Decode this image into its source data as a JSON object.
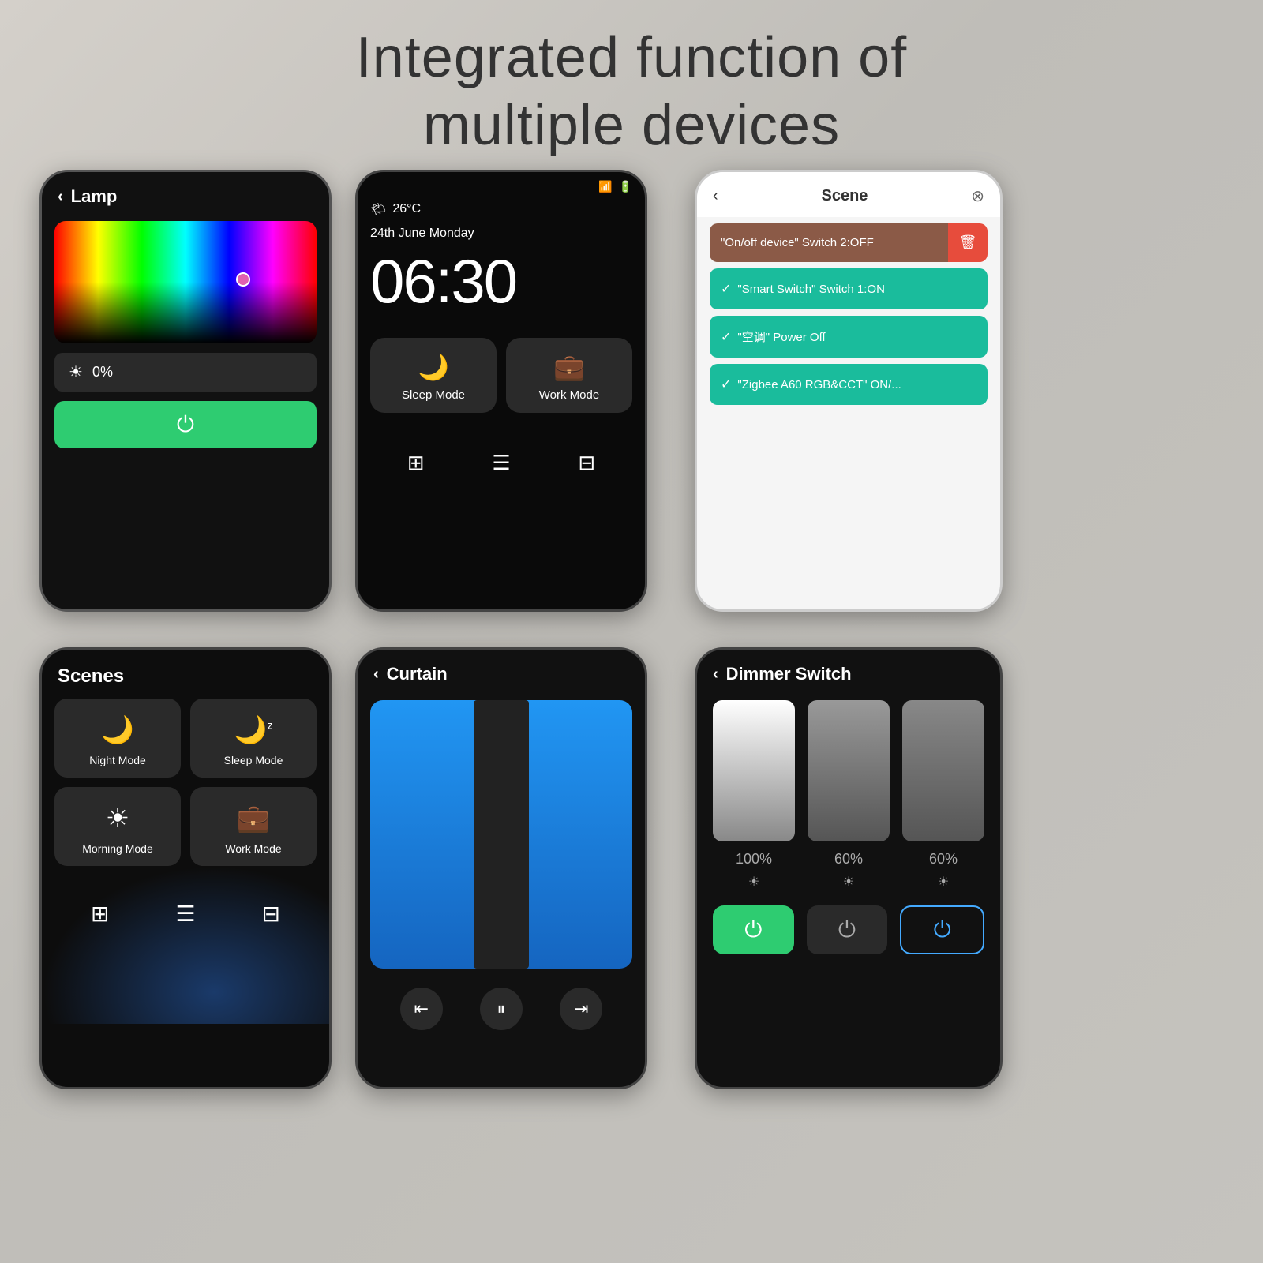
{
  "page": {
    "heading_line1": "Integrated function of",
    "heading_line2": "multiple devices",
    "bg_color": "#c8c5be"
  },
  "phone1": {
    "title": "Lamp",
    "brightness": "0%",
    "power_icon": "⏻"
  },
  "phone2": {
    "temperature": "26°C",
    "date": "24th June  Monday",
    "time": "06:30",
    "btn1_label": "Sleep Mode",
    "btn2_label": "Work Mode"
  },
  "phone3": {
    "title": "Scene",
    "row1": "\"On/off device\" Switch 2:OFF",
    "row2": "\"Smart Switch\" Switch 1:ON",
    "row3": "\"空调\" Power Off",
    "row4": "\"Zigbee A60 RGB&CCT\" ON/..."
  },
  "phone4": {
    "title": "Scenes",
    "tile1": "Night Mode",
    "tile2": "Sleep Mode",
    "tile3": "Morning Mode",
    "tile4": "Work Mode"
  },
  "phone5": {
    "title": "Curtain"
  },
  "phone6": {
    "title": "Dimmer Switch",
    "pct1": "100%",
    "pct2": "60%",
    "pct3": "60%"
  }
}
